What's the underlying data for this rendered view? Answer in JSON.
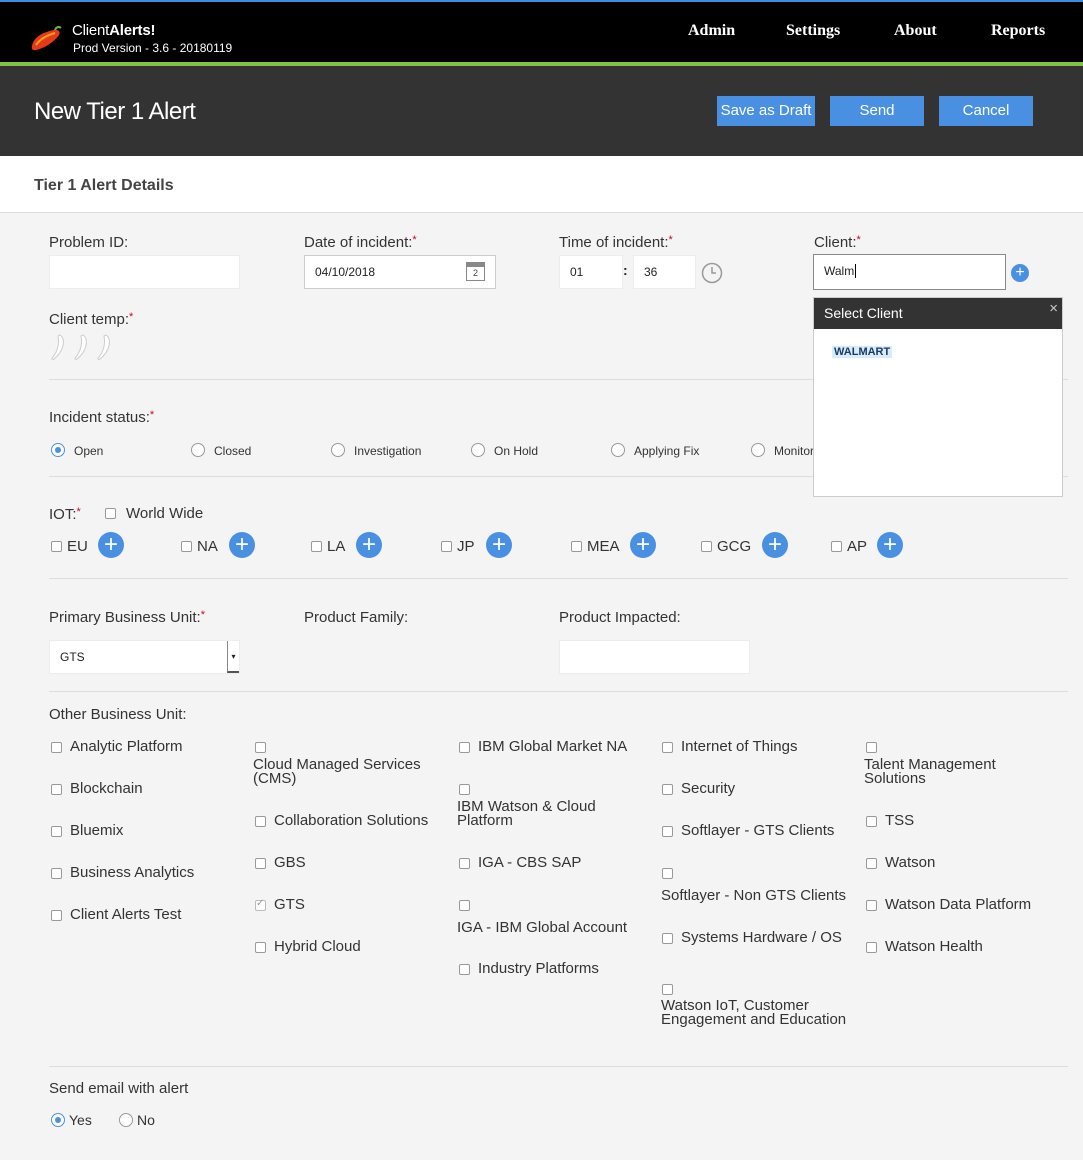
{
  "app": {
    "brand_prefix": "Client",
    "brand_suffix": "Alerts!",
    "version": "Prod Version - 3.6 - 20180119"
  },
  "nav": [
    "Admin",
    "Settings",
    "About",
    "Reports"
  ],
  "header": {
    "title": "New Tier 1 Alert",
    "buttons": {
      "draft": "Save as Draft",
      "send": "Send",
      "cancel": "Cancel"
    }
  },
  "section": {
    "title": "Tier 1 Alert Details"
  },
  "fields": {
    "problem_id": {
      "label": "Problem ID:",
      "value": ""
    },
    "date": {
      "label": "Date of incident:",
      "value": "04/10/2018",
      "calendar_day": "2"
    },
    "time": {
      "label": "Time of incident:",
      "hour": "01",
      "minute": "36",
      "separator": ":"
    },
    "client": {
      "label": "Client:",
      "value": "Walm"
    },
    "client_temp": {
      "label": "Client temp:"
    }
  },
  "client_dropdown": {
    "title": "Select Client",
    "close": "×",
    "items": [
      "WALMART"
    ]
  },
  "incident_status": {
    "label": "Incident status:",
    "options": [
      "Open",
      "Closed",
      "Investigation",
      "On Hold",
      "Applying Fix",
      "Monitor"
    ],
    "selected": "Open"
  },
  "iot": {
    "label": "IOT:",
    "world_wide": "World Wide",
    "regions": [
      "EU",
      "NA",
      "LA",
      "JP",
      "MEA",
      "GCG",
      "AP"
    ]
  },
  "business": {
    "primary_label": "Primary Business Unit:",
    "primary_value": "GTS",
    "family_label": "Product Family:",
    "impacted_label": "Product Impacted:",
    "impacted_value": ""
  },
  "other_bu": {
    "label": "Other Business Unit:",
    "col1": [
      "Analytic Platform",
      "Blockchain",
      "Bluemix",
      "Business Analytics",
      "Client Alerts Test"
    ],
    "col2": [
      "Cloud Managed Services (CMS)",
      "Collaboration Solutions",
      "GBS",
      "GTS",
      "Hybrid Cloud"
    ],
    "col3": [
      "IBM Global Market NA",
      "IBM Watson & Cloud Platform",
      "IGA - CBS SAP",
      "IGA - IBM Global Account",
      "Industry Platforms"
    ],
    "col4": [
      "Internet of Things",
      "Security",
      "Softlayer - GTS Clients",
      "Softlayer - Non GTS Clients",
      "Systems Hardware / OS",
      "Watson IoT, Customer Engagement and Education"
    ],
    "col5": [
      "Talent Management Solutions",
      "TSS",
      "Watson",
      "Watson Data Platform",
      "Watson Health"
    ],
    "checked": [
      "GTS"
    ]
  },
  "email": {
    "label": "Send email with alert",
    "yes": "Yes",
    "no": "No",
    "selected": "Yes"
  },
  "colors": {
    "accent": "#4a90e2",
    "brand_green": "#84c341",
    "header_bg": "#333333"
  }
}
